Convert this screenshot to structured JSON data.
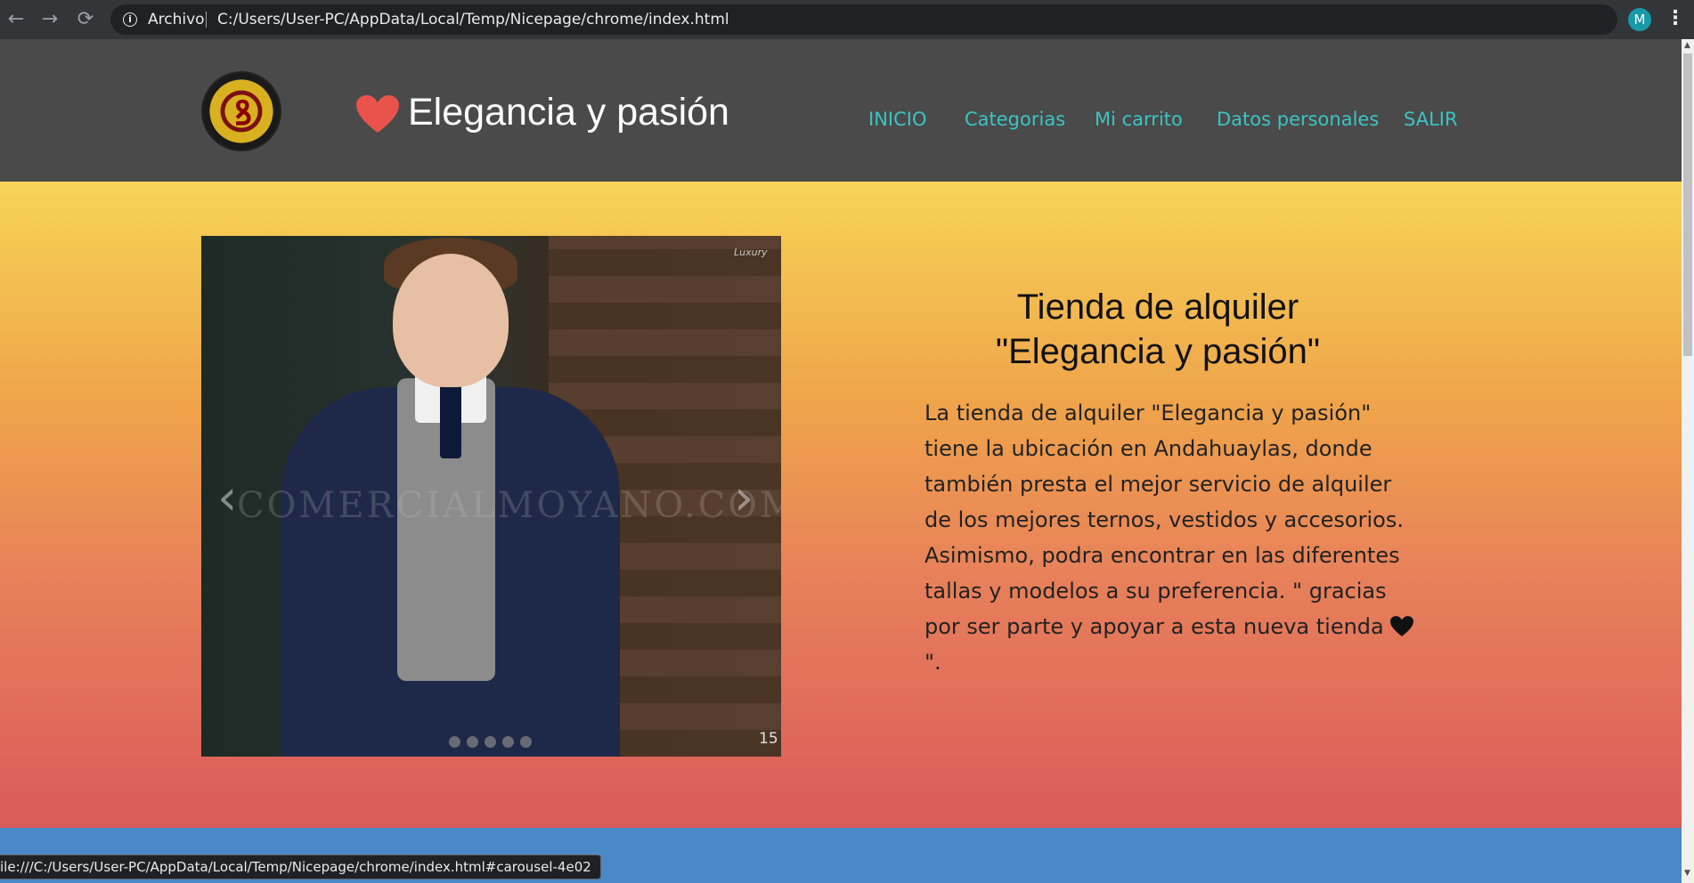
{
  "browser": {
    "url_prefix": "Archivo",
    "url": "C:/Users/User-PC/AppData/Local/Temp/Nicepage/chrome/index.html",
    "avatar_letter": "M",
    "back_icon": "←",
    "forward_icon": "→",
    "reload_icon": "⟳",
    "star_icon": "☆",
    "menu_icon": "⋮",
    "info_icon": "i"
  },
  "header": {
    "title": "Elegancia y pasión",
    "heart_color": "#e8534b",
    "nav": [
      "INICIO",
      "Categorias",
      "Mi carrito",
      "Datos personales",
      "SALIR"
    ],
    "nav_color": "#3bc4c2"
  },
  "hero": {
    "title_line1": "Tienda de alquiler",
    "title_line2": "\"Elegancia y pasión\"",
    "body": "La tienda de alquiler \"Elegancia y pasión\" tiene la ubicación en Andahuaylas, donde también presta el mejor servicio de alquiler de los mejores ternos, vestidos y accesorios. Asimismo, podra encontrar en las diferentes tallas y modelos a su preferencia. \" gracias por ser parte y apoyar a esta nueva tienda",
    "body_end": " \".",
    "carousel": {
      "watermark": "COMERCIALMOYANO.COM",
      "slide_number": "15",
      "prev_icon": "‹",
      "next_icon": "›",
      "dot_count": 5,
      "brand": "Luxury"
    }
  },
  "status": {
    "hover_url": "ile:///C:/Users/User-PC/AppData/Local/Temp/Nicepage/chrome/index.html#carousel-4e02"
  }
}
